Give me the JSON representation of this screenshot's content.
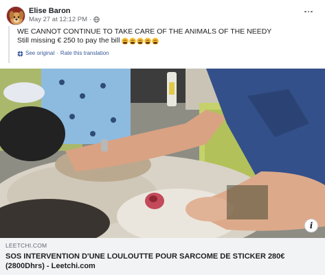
{
  "post": {
    "author": "Elise Baron",
    "timestamp": "May 27 at 12:12 PM",
    "separator": "·",
    "privacy_icon": "globe-icon",
    "more_icon": "more-options-icon"
  },
  "body": {
    "line1": "WE CANNOT CONTINUE TO TAKE CARE OF THE ANIMALS OF THE NEEDY",
    "line2": "Still missing € 250 to pay the bill",
    "emoji_name": "crying-face-icon",
    "emoji_count": 5,
    "see_original": "See original",
    "translation_separator": "·",
    "rate_translation": "Rate this translation"
  },
  "link": {
    "domain": "LEETCHI.COM",
    "title_line1": "SOS INTERVENTION D'UNE LOULOUTTE POUR SARCOME DE STICKER 280€",
    "title_line2": "(2800Dhrs) - Leetchi.com",
    "info_label": "i"
  },
  "colors": {
    "link_blue": "#385898",
    "meta_gray": "#65676b",
    "preview_bg": "#f2f3f5",
    "emoji_yellow": "#f7c23a"
  }
}
